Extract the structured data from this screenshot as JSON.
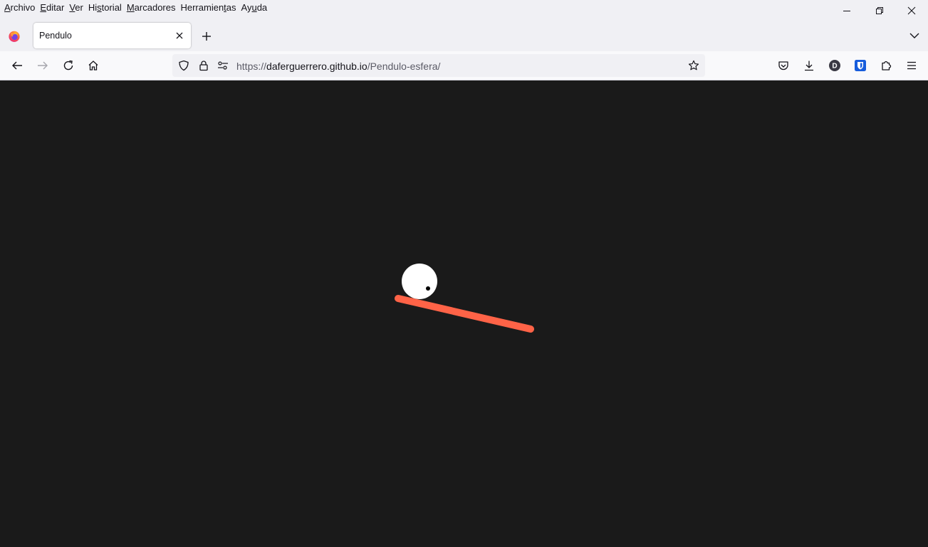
{
  "menubar": {
    "items": [
      {
        "pre": "",
        "key": "A",
        "post": "rchivo"
      },
      {
        "pre": "",
        "key": "E",
        "post": "ditar"
      },
      {
        "pre": "",
        "key": "V",
        "post": "er"
      },
      {
        "pre": "Hi",
        "key": "s",
        "post": "torial"
      },
      {
        "pre": "",
        "key": "M",
        "post": "arcadores"
      },
      {
        "pre": "Herramien",
        "key": "t",
        "post": "as"
      },
      {
        "pre": "Ay",
        "key": "u",
        "post": "da"
      }
    ]
  },
  "tab": {
    "title": "Pendulo"
  },
  "navbar": {
    "url_scheme": "https://",
    "url_host": "daferguerrero.github.io",
    "url_path": "/Pendulo-esfera/",
    "account_initial": "D"
  },
  "colors": {
    "background": "#1a1a1a",
    "ball": "#ffffff",
    "bar": "#ff6347",
    "dot": "#000000",
    "bitwarden": "#175ddc"
  },
  "icons": {
    "firefox": "firefox-logo-icon",
    "back": "arrow-left-icon",
    "forward": "arrow-right-icon",
    "reload": "reload-icon",
    "home": "home-icon",
    "shield": "tracking-shield-icon",
    "lock": "lock-icon",
    "permissions": "permissions-icon",
    "bookmark": "star-icon",
    "pocket": "pocket-icon",
    "downloads": "download-icon",
    "account": "account-avatar-icon",
    "bitwarden": "bitwarden-icon",
    "extensions": "puzzle-icon",
    "menu": "hamburger-menu-icon"
  }
}
